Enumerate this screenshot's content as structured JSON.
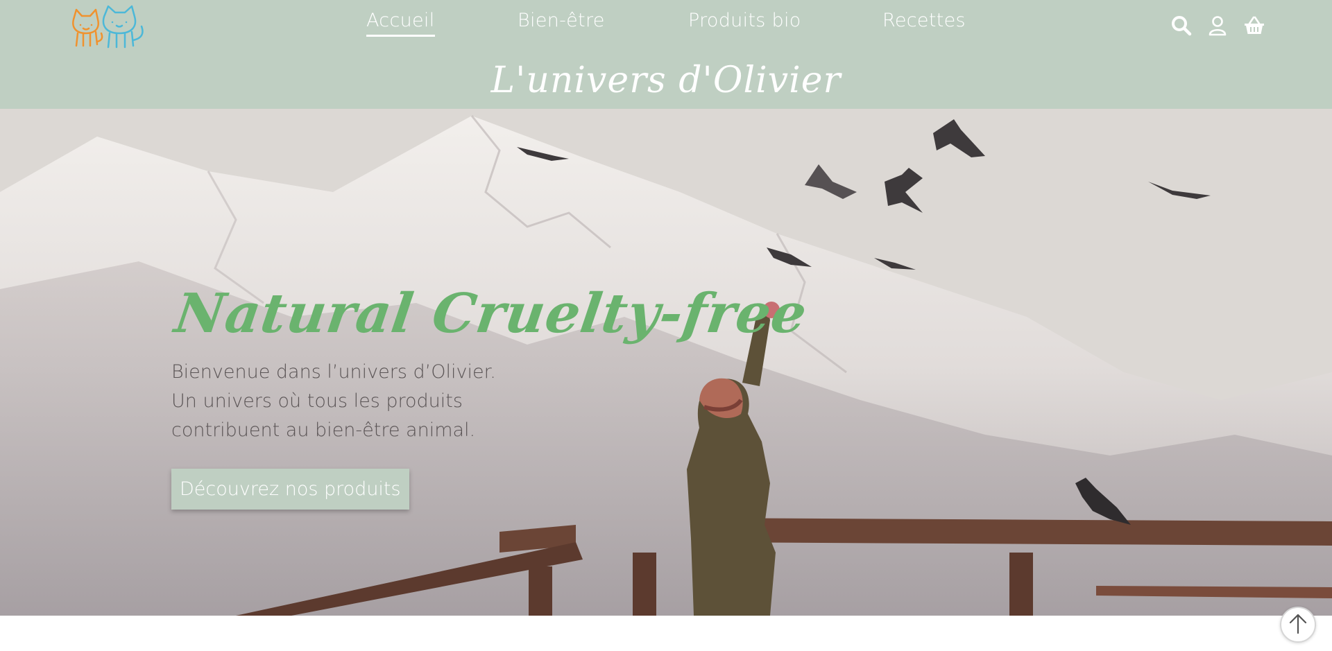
{
  "header": {
    "site_title": "L'univers d'Olivier",
    "nav": [
      {
        "label": "Accueil",
        "active": true
      },
      {
        "label": "Bien-être",
        "active": false
      },
      {
        "label": "Produits bio",
        "active": false
      },
      {
        "label": "Recettes",
        "active": false
      }
    ],
    "icons": [
      "search-icon",
      "user-icon",
      "basket-icon"
    ],
    "logo": "cats-logo"
  },
  "hero": {
    "title": "Natural Cruelty-free",
    "lines": [
      "Bienvenue dans l’univers d’Olivier.",
      "Un univers où tous les produits",
      "contribuent au bien-être animal."
    ],
    "cta_label": "Découvrez nos produits"
  },
  "colors": {
    "header_bg": "#bfcfc2",
    "accent_green": "#6ab36e",
    "text_gray": "#5a5455"
  },
  "back_to_top_icon": "arrow-up-icon"
}
